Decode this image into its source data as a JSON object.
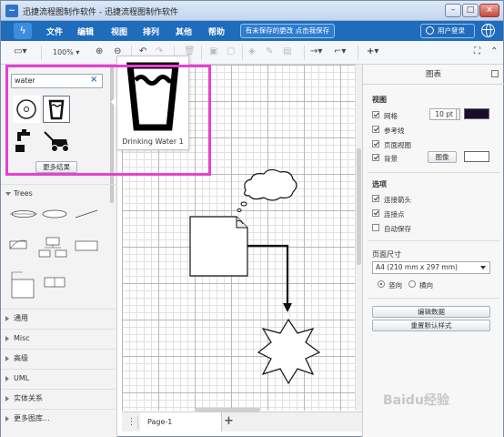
{
  "app": {
    "title": "迅捷流程图制作软件 - 迅捷流程图制作软件",
    "window_controls": [
      "minimize",
      "maximize",
      "close"
    ]
  },
  "menubar": {
    "items": [
      "文件",
      "编辑",
      "视图",
      "排列",
      "其他",
      "帮助"
    ],
    "save_notice": "有未保存的更改 点击我保存",
    "login_label": "用户登录"
  },
  "toolbar": {
    "zoom": "100%",
    "icons": [
      "page-view-icon",
      "zoom-in-icon",
      "zoom-out-icon",
      "undo-icon",
      "redo-icon",
      "delete-icon",
      "to-front-icon",
      "to-back-icon",
      "fill-color-icon",
      "line-color-icon",
      "shadow-icon",
      "connection-icon",
      "waypoint-icon",
      "insert-icon",
      "fullscreen-icon",
      "collapse-icon"
    ]
  },
  "sidebar": {
    "search_value": "water",
    "search_results": [
      "cd-icon",
      "drinking-water-icon",
      "faucet-icon",
      "lawn-mower-icon"
    ],
    "more_results_label": "更多结果",
    "trees_label": "Trees",
    "sections": [
      "通用",
      "Misc",
      "高级",
      "UML",
      "实体关系"
    ],
    "more_libraries_label": "更多图库..."
  },
  "preview": {
    "caption": "Drinking Water 1"
  },
  "pages": {
    "tabs": [
      "Page-1"
    ]
  },
  "right_panel": {
    "title": "图表",
    "view_section": "视图",
    "grid_label": "网格",
    "grid_size": "10 pt",
    "guides_label": "参考线",
    "page_view_label": "页面视图",
    "background_label": "背景",
    "image_button": "图像",
    "options_section": "选项",
    "connection_arrows_label": "连接箭头",
    "connection_points_label": "连接点",
    "autosave_label": "自动保存",
    "paper_size_section": "页面尺寸",
    "paper_size_value": "A4 (210 mm x 297 mm)",
    "portrait_label": "竖向",
    "landscape_label": "横向",
    "edit_data_button": "编辑数据",
    "reset_style_button": "重置默认样式",
    "colors": {
      "grid_color": "#1a0d2b",
      "background_color": "#ffffff"
    }
  },
  "watermark": "Baidu经验"
}
